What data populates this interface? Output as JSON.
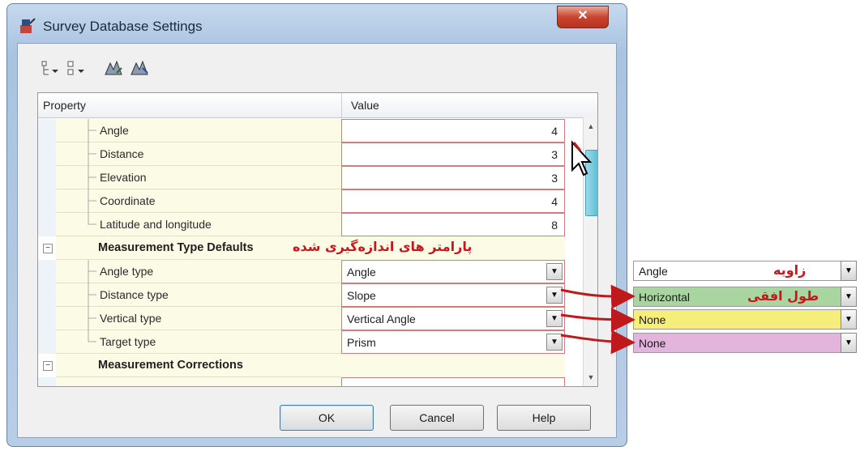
{
  "window": {
    "title": "Survey Database Settings",
    "close_label": "✕"
  },
  "grid": {
    "header": {
      "property": "Property",
      "value": "Value"
    },
    "precision_rows": [
      {
        "label": "Angle",
        "value": "4"
      },
      {
        "label": "Distance",
        "value": "3"
      },
      {
        "label": "Elevation",
        "value": "3"
      },
      {
        "label": "Coordinate",
        "value": "4"
      },
      {
        "label": "Latitude and longitude",
        "value": "8"
      }
    ],
    "category1": {
      "label": "Measurement Type Defaults",
      "annotation": "پارامتر های اندازه‌گیری شده"
    },
    "type_rows": [
      {
        "label": "Angle type",
        "value": "Angle"
      },
      {
        "label": "Distance type",
        "value": "Slope"
      },
      {
        "label": "Vertical type",
        "value": "Vertical Angle"
      },
      {
        "label": "Target type",
        "value": "Prism"
      }
    ],
    "category2": {
      "label": "Measurement Corrections"
    }
  },
  "buttons": {
    "ok": "OK",
    "cancel": "Cancel",
    "help": "Help"
  },
  "callouts": [
    {
      "value": "Angle",
      "note": "زاویه",
      "color": "#ffffff"
    },
    {
      "value": "Horizontal",
      "note": "طول افقی",
      "color": "#a8d5a0"
    },
    {
      "value": "None",
      "note": "",
      "color": "#f5ee7a"
    },
    {
      "value": "None",
      "note": "",
      "color": "#e3b5dc"
    }
  ],
  "colors": {
    "annotation_red": "#c7161c",
    "arrow_red": "#c0191b"
  }
}
